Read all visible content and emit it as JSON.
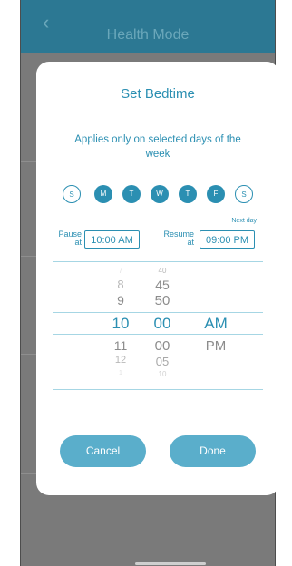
{
  "header": {
    "title": "Health Mode",
    "back_icon": "chevron-left-icon"
  },
  "dialog": {
    "title": "Set Bedtime",
    "description": "Applies only on selected days of the week",
    "days": [
      {
        "letter": "S",
        "selected": false
      },
      {
        "letter": "M",
        "selected": true
      },
      {
        "letter": "T",
        "selected": true
      },
      {
        "letter": "W",
        "selected": true
      },
      {
        "letter": "T",
        "selected": true
      },
      {
        "letter": "F",
        "selected": true
      },
      {
        "letter": "S",
        "selected": false
      }
    ],
    "pause": {
      "label_line1": "Pause",
      "label_line2": "at",
      "value": "10:00 AM"
    },
    "resume": {
      "label_line1": "Resume",
      "label_line2": "at",
      "value": "09:00 PM",
      "note": "Next day"
    },
    "picker": {
      "hours": [
        "7",
        "8",
        "9",
        "10",
        "11",
        "12",
        "1"
      ],
      "minutes": [
        "40",
        "45",
        "50",
        "00",
        "00",
        "05",
        "10"
      ],
      "periods": [
        "AM",
        "PM"
      ],
      "selected": {
        "hour": "10",
        "minute": "00",
        "period": "AM"
      }
    },
    "cancel_label": "Cancel",
    "done_label": "Done"
  },
  "colors": {
    "accent": "#2b8fb2",
    "button": "#5aaecb",
    "header": "#2c7893",
    "dim_overlay": "#7a7a7a"
  }
}
